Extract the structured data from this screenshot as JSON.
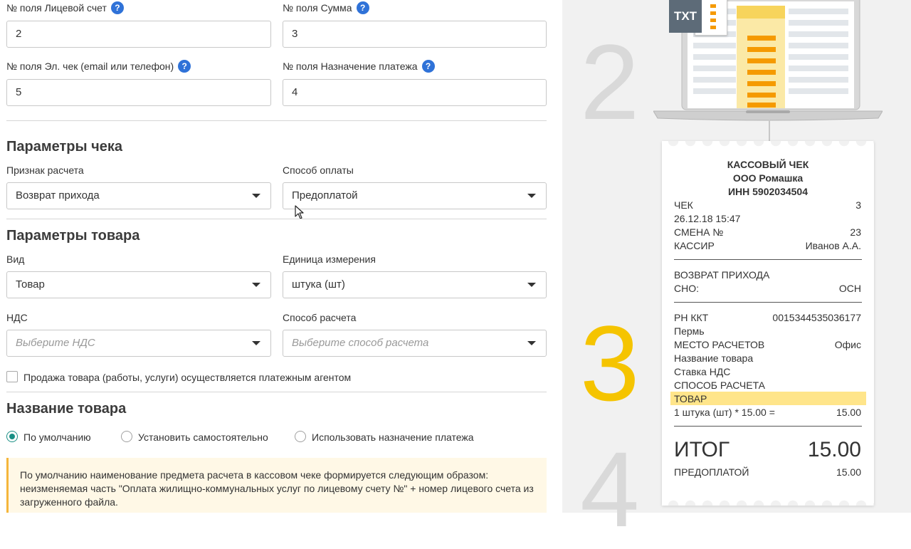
{
  "fields": {
    "account_label": "№ поля Лицевой счет",
    "account_value": "2",
    "sum_label": "№ поля Сумма",
    "sum_value": "3",
    "echeck_label": "№ поля Эл. чек (email или телефон)",
    "echeck_value": "5",
    "purpose_label": "№ поля Назначение платежа",
    "purpose_value": "4",
    "help_glyph": "?"
  },
  "check_params": {
    "title": "Параметры чека",
    "calc_sign_label": "Признак расчета",
    "calc_sign_value": "Возврат прихода",
    "payment_method_label": "Способ оплаты",
    "payment_method_value": "Предоплатой"
  },
  "product_params": {
    "title": "Параметры товара",
    "kind_label": "Вид",
    "kind_value": "Товар",
    "unit_label": "Единица измерения",
    "unit_value": "штука (шт)",
    "vat_label": "НДС",
    "vat_placeholder": "Выберите НДС",
    "calc_method_label": "Способ расчета",
    "calc_method_placeholder": "Выберите способ расчета",
    "agent_checkbox_label": "Продажа товара (работы, услуги) осуществляется платежным агентом",
    "agent_checked": false
  },
  "product_name": {
    "title": "Название товара",
    "options": [
      {
        "label": "По умолчанию",
        "selected": true
      },
      {
        "label": "Установить самостоятельно",
        "selected": false
      },
      {
        "label": "Использовать назначение платежа",
        "selected": false
      }
    ],
    "note": "По умолчанию наименование предмета расчета в кассовом чеке формируется следующим образом: неизменяемая часть \"Оплата жилищно-коммунальных услуг по лицевому счету №\" + номер лицевого счета из загруженного файла."
  },
  "illustration": {
    "steps": [
      "2",
      "3",
      "4"
    ],
    "file_badge": "TXT",
    "colors": {
      "highlight": "#f5c400",
      "step_gray": "#d9d9d9",
      "accent_orange": "#f59a00"
    }
  },
  "receipt": {
    "title": "КАССОВЫЙ ЧЕК",
    "org": "ООО Ромашка",
    "inn": "ИНН 5902034504",
    "check_label": "ЧЕК",
    "check_no": "3",
    "datetime": "26.12.18 15:47",
    "shift_label": "СМЕНА №",
    "shift_no": "23",
    "cashier_label": "КАССИР",
    "cashier_name": "Иванов А.А.",
    "calc_type": "ВОЗВРАТ ПРИХОДА",
    "sno_label": "СНО:",
    "sno_value": "ОСН",
    "rn_label": "РН ККТ",
    "rn_value": "0015344535036177",
    "city": "Пермь",
    "place_label": "МЕСТО РАСЧЕТОВ",
    "place_value": "Офис",
    "product_name": "Название товара",
    "vat_rate": "Ставка НДС",
    "calc_method": "СПОСОБ РАСЧЕТА",
    "item_kind": "ТОВАР",
    "qty_line": "1 штука (шт) * 15.00 =",
    "qty_sum": "15.00",
    "total_label": "ИТОГ",
    "total_value": "15.00",
    "prepay_label": "ПРЕДОПЛАТОЙ",
    "prepay_value": "15.00"
  }
}
